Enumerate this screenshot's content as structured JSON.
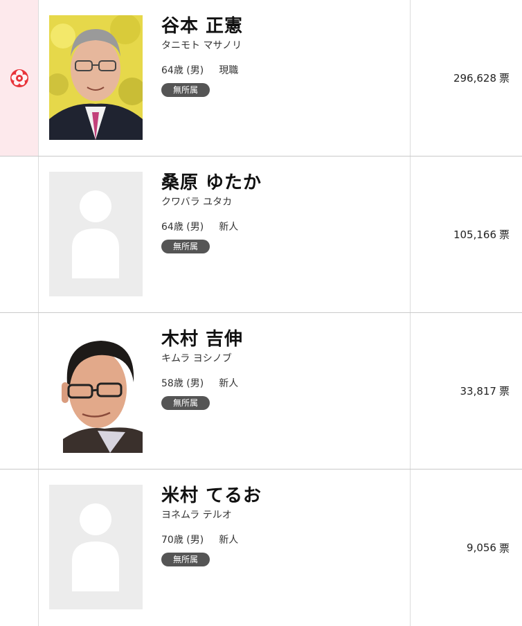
{
  "candidates": [
    {
      "name": "谷本 正憲",
      "kana": "タニモト マサノリ",
      "age_sex": "64歳 (男)",
      "status": "現職",
      "party": "無所属",
      "votes": "296,628",
      "vote_unit": "票",
      "elected": true,
      "photo": "portrait-photo"
    },
    {
      "name": "桑原 ゆたか",
      "kana": "クワバラ ユタカ",
      "age_sex": "64歳 (男)",
      "status": "新人",
      "party": "無所属",
      "votes": "105,166",
      "vote_unit": "票",
      "elected": false,
      "photo": "placeholder-silhouette"
    },
    {
      "name": "木村 吉伸",
      "kana": "キムラ ヨシノブ",
      "age_sex": "58歳 (男)",
      "status": "新人",
      "party": "無所属",
      "votes": "33,817",
      "vote_unit": "票",
      "elected": false,
      "photo": "portrait-photo"
    },
    {
      "name": "米村 てるお",
      "kana": "ヨネムラ テルオ",
      "age_sex": "70歳 (男)",
      "status": "新人",
      "party": "無所属",
      "votes": "9,056",
      "vote_unit": "票",
      "elected": false,
      "photo": "placeholder-silhouette"
    }
  ],
  "colors": {
    "elected_bg": "#fde9ec",
    "rose": "#e8343a",
    "party_badge": "#555555"
  },
  "icons": {
    "elected_marker": "rose-icon"
  }
}
